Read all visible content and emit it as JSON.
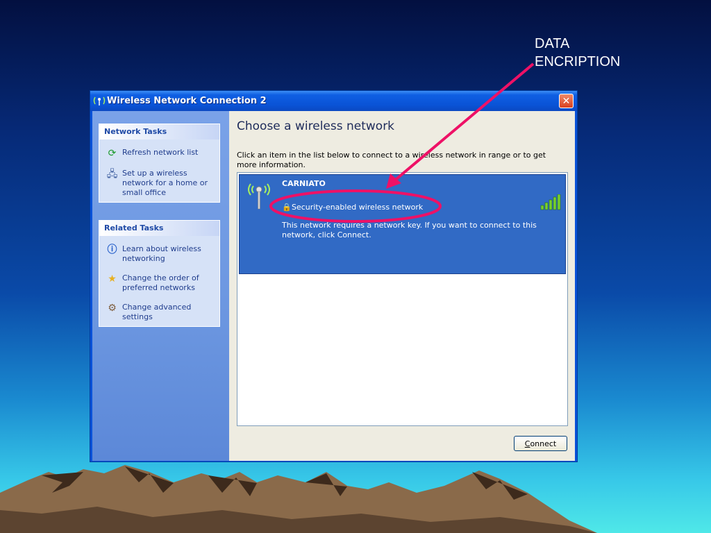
{
  "annotation": {
    "line1": "DATA",
    "line2": "ENCRIPTION"
  },
  "window": {
    "title": "Wireless Network Connection 2",
    "close_label": "✕"
  },
  "network_tasks": {
    "header": "Network Tasks",
    "items": [
      {
        "label": "Refresh network list",
        "icon": "refresh-icon"
      },
      {
        "label": "Set up a wireless network for a home or small office",
        "icon": "setup-wireless-icon"
      }
    ]
  },
  "related_tasks": {
    "header": "Related Tasks",
    "items": [
      {
        "label": "Learn about wireless networking",
        "icon": "info-icon"
      },
      {
        "label": "Change the order of preferred networks",
        "icon": "star-icon"
      },
      {
        "label": "Change advanced settings",
        "icon": "settings-icon"
      }
    ]
  },
  "main": {
    "title": "Choose a wireless network",
    "description": "Click an item in the list below to connect to a wireless network in range or to get more information."
  },
  "network": {
    "name": "CARNIATO",
    "security": "Security-enabled wireless network",
    "note": "This network requires a network key. If you want to connect to this network, click Connect.",
    "signal_bars": 5
  },
  "connect_button": {
    "label_first": "C",
    "label_rest": "onnect"
  },
  "colors": {
    "highlight": "#ee1166",
    "selection": "#316ac5",
    "titlebar": "#0a53d6"
  }
}
